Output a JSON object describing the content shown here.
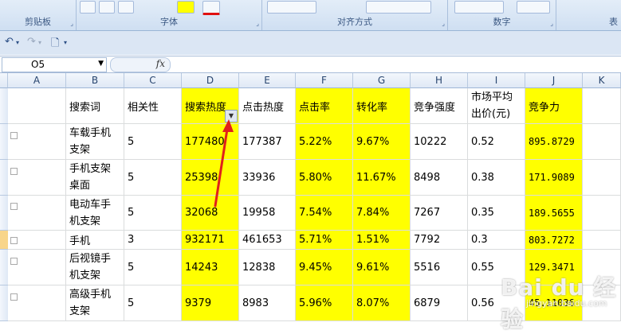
{
  "ribbon": {
    "groups": [
      {
        "label": "剪贴板"
      },
      {
        "label": "字体"
      },
      {
        "label": "对齐方式"
      },
      {
        "label": "数字"
      },
      {
        "label": "表"
      }
    ]
  },
  "qat": {
    "undo_icon": "undo-icon",
    "redo_icon": "redo-icon",
    "preview_icon": "print-preview-icon"
  },
  "formula_bar": {
    "name_box": "O5",
    "fx": "fx"
  },
  "columns": [
    "A",
    "B",
    "C",
    "D",
    "E",
    "F",
    "G",
    "H",
    "I",
    "J",
    "K"
  ],
  "headers": {
    "B": "搜索词",
    "C": "相关性",
    "D": "搜索热度",
    "E": "点击热度",
    "F": "点击率",
    "G": "转化率",
    "H": "竞争强度",
    "I": "市场平均出价(元)",
    "J": "竞争力"
  },
  "rows": [
    {
      "B": "车载手机支架",
      "C": "5",
      "D": "177480",
      "E": "177387",
      "F": "5.22%",
      "G": "9.67%",
      "H": "10222",
      "I": "0.52",
      "J": "895.8729"
    },
    {
      "B": "手机支架桌面",
      "C": "5",
      "D": "25398",
      "E": "33936",
      "F": "5.80%",
      "G": "11.67%",
      "H": "8498",
      "I": "0.38",
      "J": "171.9089"
    },
    {
      "B": "电动车手机支架",
      "C": "5",
      "D": "32068",
      "E": "19958",
      "F": "7.54%",
      "G": "7.84%",
      "H": "7267",
      "I": "0.35",
      "J": "189.5655"
    },
    {
      "B": "手机",
      "C": "3",
      "D": "932171",
      "E": "461653",
      "F": "5.71%",
      "G": "1.51%",
      "H": "7792",
      "I": "0.3",
      "J": "803.7272"
    },
    {
      "B": "后视镜手机支架",
      "C": "5",
      "D": "14243",
      "E": "12838",
      "F": "9.45%",
      "G": "9.61%",
      "H": "5516",
      "I": "0.55",
      "J": "129.3471"
    },
    {
      "B": "高级手机支架",
      "C": "5",
      "D": "9379",
      "E": "8983",
      "F": "5.96%",
      "G": "8.07%",
      "H": "6879",
      "I": "0.56",
      "J": "45.11036"
    }
  ],
  "watermark": {
    "brand": "Bai du 经验",
    "url": "jingyan.baidu.com"
  },
  "colors": {
    "highlight": "#ffff00",
    "annotation_arrow": "#e0201b"
  }
}
